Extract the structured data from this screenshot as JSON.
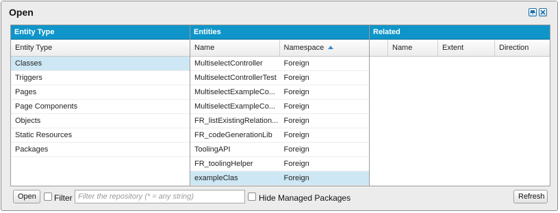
{
  "window": {
    "title": "Open"
  },
  "entity_type_panel": {
    "header": "Entity Type",
    "column": "Entity Type",
    "items": [
      {
        "label": "Classes",
        "selected": true
      },
      {
        "label": "Triggers",
        "selected": false
      },
      {
        "label": "Pages",
        "selected": false
      },
      {
        "label": "Page Components",
        "selected": false
      },
      {
        "label": "Objects",
        "selected": false
      },
      {
        "label": "Static Resources",
        "selected": false
      },
      {
        "label": "Packages",
        "selected": false
      }
    ]
  },
  "entities_panel": {
    "header": "Entities",
    "columns": {
      "name": "Name",
      "namespace": "Namespace"
    },
    "sort": {
      "column": "namespace",
      "direction": "ascending"
    },
    "rows": [
      {
        "name": "MultiselectController",
        "namespace": "Foreign",
        "selected": false
      },
      {
        "name": "MultiselectControllerTest",
        "namespace": "Foreign",
        "selected": false
      },
      {
        "name": "MultiselectExampleCo...",
        "namespace": "Foreign",
        "selected": false
      },
      {
        "name": "MultiselectExampleCo...",
        "namespace": "Foreign",
        "selected": false
      },
      {
        "name": "FR_listExistingRelation...",
        "namespace": "Foreign",
        "selected": false
      },
      {
        "name": "FR_codeGenerationLib",
        "namespace": "Foreign",
        "selected": false
      },
      {
        "name": "ToolingAPI",
        "namespace": "Foreign",
        "selected": false
      },
      {
        "name": "FR_toolingHelper",
        "namespace": "Foreign",
        "selected": false
      },
      {
        "name": "exampleClas",
        "namespace": "Foreign",
        "selected": true
      }
    ]
  },
  "related_panel": {
    "header": "Related",
    "columns": {
      "blank": "",
      "name": "Name",
      "extent": "Extent",
      "direction": "Direction"
    }
  },
  "footer": {
    "open_label": "Open",
    "filter_label": "Filter",
    "filter_checked": false,
    "filter_placeholder": "Filter the repository (* = any string)",
    "filter_value": "",
    "hide_managed_label": "Hide Managed Packages",
    "hide_managed_checked": false,
    "refresh_label": "Refresh"
  },
  "colors": {
    "panel_header": "#0f95c9",
    "selection": "#cde8f4",
    "dialog_background": "#ececec"
  },
  "icons": [
    "pin-icon",
    "close-icon",
    "sort-ascending-icon"
  ]
}
